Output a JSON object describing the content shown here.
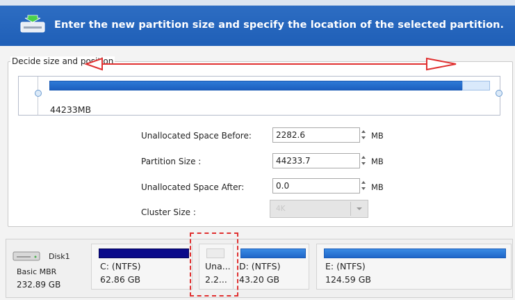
{
  "header": {
    "title": "Enter the new partition size and specify the location of the selected partition."
  },
  "group": {
    "legend": "Decide size and position"
  },
  "slider": {
    "size_label": "44233MB",
    "filled_fraction": 0.94
  },
  "fields": {
    "before": {
      "label": "Unallocated Space Before:",
      "value": "2282.6",
      "unit": "MB"
    },
    "size": {
      "label": "Partition Size :",
      "value": "44233.7",
      "unit": "MB"
    },
    "after": {
      "label": "Unallocated Space After:",
      "value": "0.0",
      "unit": "MB"
    },
    "cluster": {
      "label": "Cluster Size :",
      "value": "4K"
    }
  },
  "disk": {
    "name": "Disk1",
    "type": "Basic MBR",
    "size": "232.89 GB"
  },
  "partitions": [
    {
      "name": "C: (NTFS)",
      "size": "62.86 GB",
      "color": "#0a0a8a"
    },
    {
      "name": "Una...",
      "size": "2.2...",
      "color": "#e8e8e8"
    },
    {
      "name": "D: (NTFS)",
      "size": "43.20 GB",
      "color": "#2878d8"
    },
    {
      "name": "E: (NTFS)",
      "size": "124.59 GB",
      "color": "#2878d8"
    }
  ],
  "colors": {
    "header": "#2563b8",
    "annotation": "#e03030"
  }
}
